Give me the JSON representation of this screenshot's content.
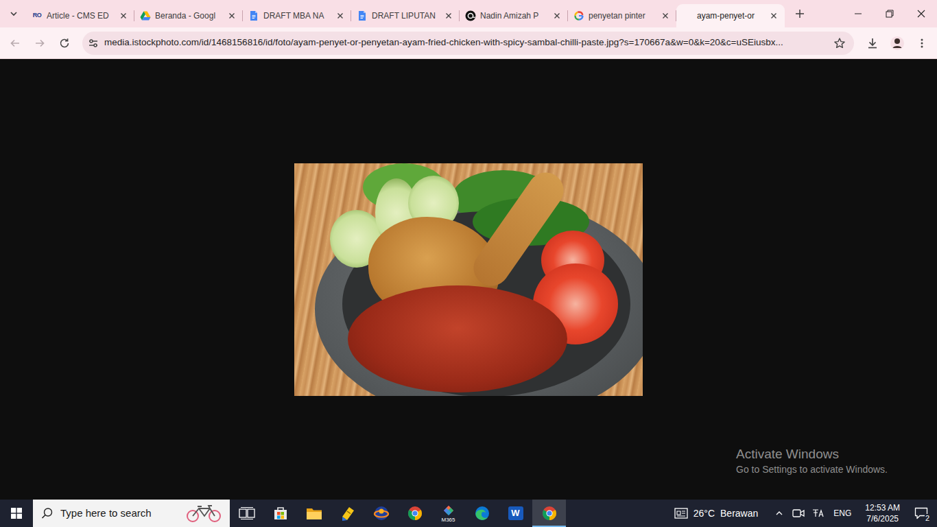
{
  "tabs": [
    {
      "label": "Article - CMS ED",
      "selected": false,
      "kind": "ro",
      "icon_text": "RO"
    },
    {
      "label": "Beranda - Googl",
      "selected": false,
      "kind": "drive"
    },
    {
      "label": "DRAFT MBA NA",
      "selected": false,
      "kind": "docs"
    },
    {
      "label": "DRAFT LIPUTAN",
      "selected": false,
      "kind": "docs"
    },
    {
      "label": "Nadin Amizah P",
      "selected": false,
      "kind": "threads"
    },
    {
      "label": "penyetan pinter",
      "selected": false,
      "kind": "google"
    },
    {
      "label": "ayam-penyet-or",
      "selected": true,
      "kind": "none"
    }
  ],
  "navigation": {
    "back_enabled": false,
    "forward_enabled": false
  },
  "address_bar": {
    "url": "media.istockphoto.com/id/1468156816/id/foto/ayam-penyet-or-penyetan-ayam-fried-chicken-with-spicy-sambal-chilli-paste.jpg?s=170667a&w=0&k=20&c=uSEiusbx..."
  },
  "watermark": {
    "title": "Activate Windows",
    "subtitle": "Go to Settings to activate Windows."
  },
  "taskbar": {
    "search": {
      "placeholder": "Type here to search"
    },
    "apps": [
      {
        "kind": "task-view",
        "active": false
      },
      {
        "kind": "store",
        "active": false
      },
      {
        "kind": "explorer",
        "active": false
      },
      {
        "kind": "sticky",
        "active": false
      },
      {
        "kind": "orbit",
        "active": false
      },
      {
        "kind": "chrome",
        "active": false
      },
      {
        "kind": "m365",
        "active": false,
        "label": "M365"
      },
      {
        "kind": "edge",
        "active": false
      },
      {
        "kind": "word",
        "active": false,
        "label": "W"
      },
      {
        "kind": "chrome",
        "active": true
      }
    ],
    "weather": {
      "temperature": "26°C",
      "condition": "Berawan"
    },
    "language": "ENG",
    "clock": {
      "time": "12:53 AM",
      "date": "7/6/2025"
    },
    "notifications": "2"
  }
}
